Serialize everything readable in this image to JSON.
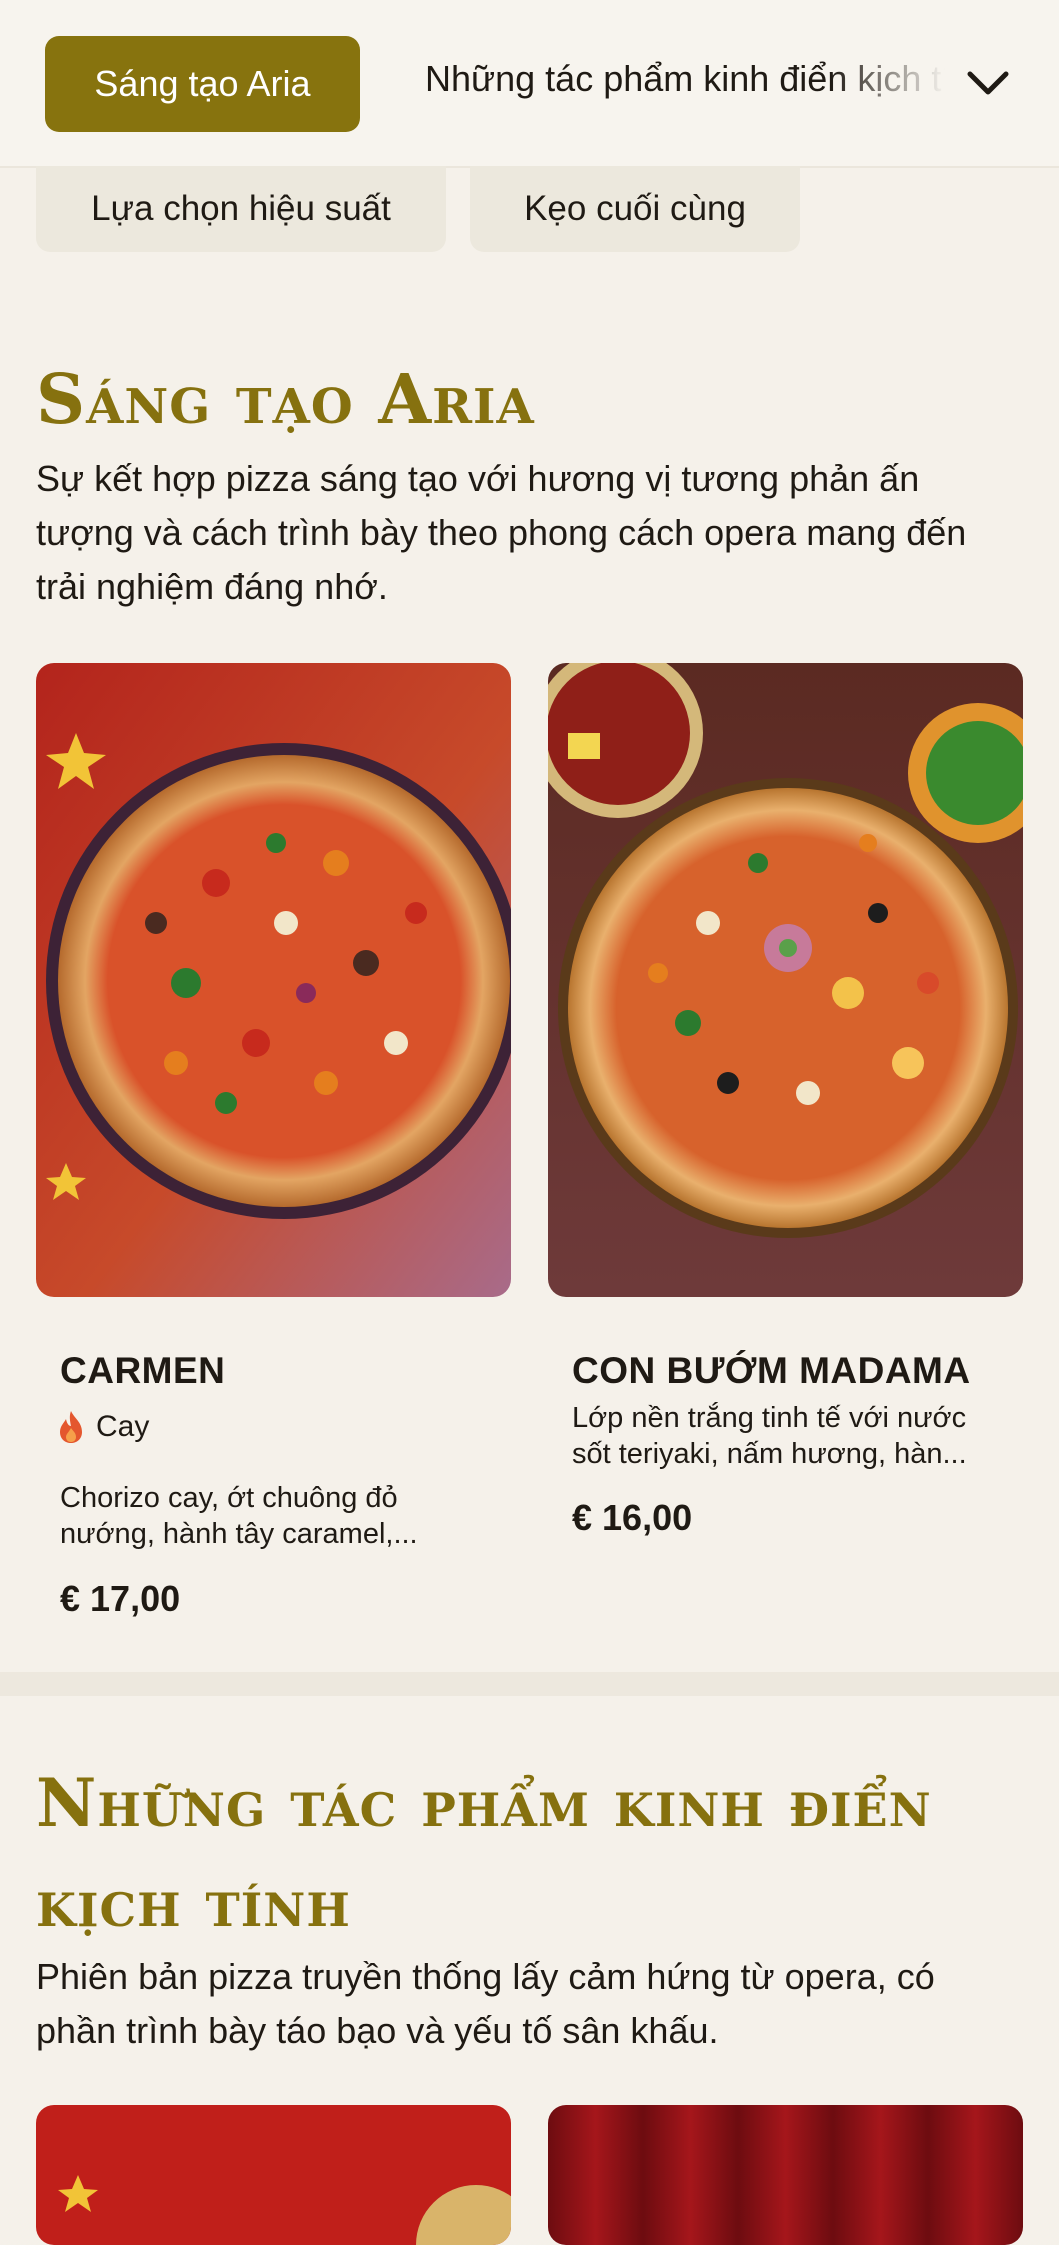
{
  "tabs": {
    "active_label": "Sáng tạo Aria",
    "next_label": "Những tác phẩm kinh điển kịch tính",
    "second_row": [
      "Lựa chọn hiệu suất",
      "Kẹo cuối cùng"
    ]
  },
  "sections": [
    {
      "title": "Sáng tạo Aria",
      "description": "Sự kết hợp pizza sáng tạo với hương vị tương phản ấn tượng và cách trình bày theo phong cách opera mang đến trải nghiệm đáng nhớ.",
      "items": [
        {
          "name": "CARMEN",
          "tag": "Cay",
          "description": "Chorizo cay, ớt chuông đỏ nướng, hành tây caramel,...",
          "price": "€ 17,00"
        },
        {
          "name": "CON BƯỚM MADAMA",
          "description": "Lớp nền trắng tinh tế với nước sốt teriyaki, nấm hương, hàn...",
          "price": "€ 16,00"
        }
      ]
    },
    {
      "title": "Những tác phẩm kinh điển kịch tính",
      "description": "Phiên bản pizza truyền thống lấy cảm hứng từ opera, có phần trình bày táo bạo và yếu tố sân khấu."
    }
  ],
  "colors": {
    "accent": "#87730e",
    "background": "#f5f1ea",
    "chip": "#ece8dd",
    "spicy": "#e4572e"
  },
  "icons": [
    "chevron-down-icon",
    "flame-icon"
  ]
}
